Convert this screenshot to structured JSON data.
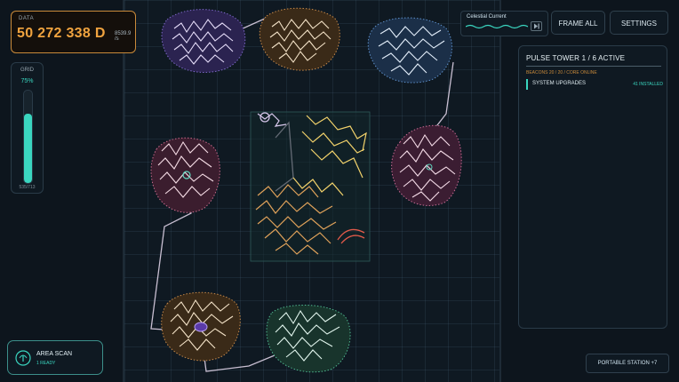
{
  "data_panel": {
    "label": "DATA",
    "value": "50 272 338 D",
    "rate": "8539.9 /s"
  },
  "grid_panel": {
    "label": "GRID",
    "percent_label": "75%",
    "fill_fraction": 0.75,
    "count": "535/713"
  },
  "area_scan": {
    "title": "AREA SCAN",
    "status": "1 READY",
    "icon": "radar-icon"
  },
  "celestial": {
    "title": "Celestial Current",
    "icon": "skip-forward-icon"
  },
  "toolbar": {
    "frame_all": "FRAME ALL",
    "settings": "SETTINGS"
  },
  "tower": {
    "title": "PULSE TOWER 1  /  6 ACTIVE",
    "subtitle": "BEACONS 20 / 20  /  CORE ONLINE",
    "rows": [
      {
        "name": "SYSTEM UPGRADES",
        "count": "41 INSTALLED"
      }
    ]
  },
  "portable_station": {
    "label": "PORTABLE STATION  +7"
  },
  "colors": {
    "accent": "#3ad6c0",
    "data": "#f0a33f",
    "purple": "#a388e8",
    "orange": "#e0a25a",
    "blue": "#7fb0e0",
    "pink": "#e895b8",
    "teal": "#5fd6b0",
    "yellow": "#f2d26b"
  }
}
